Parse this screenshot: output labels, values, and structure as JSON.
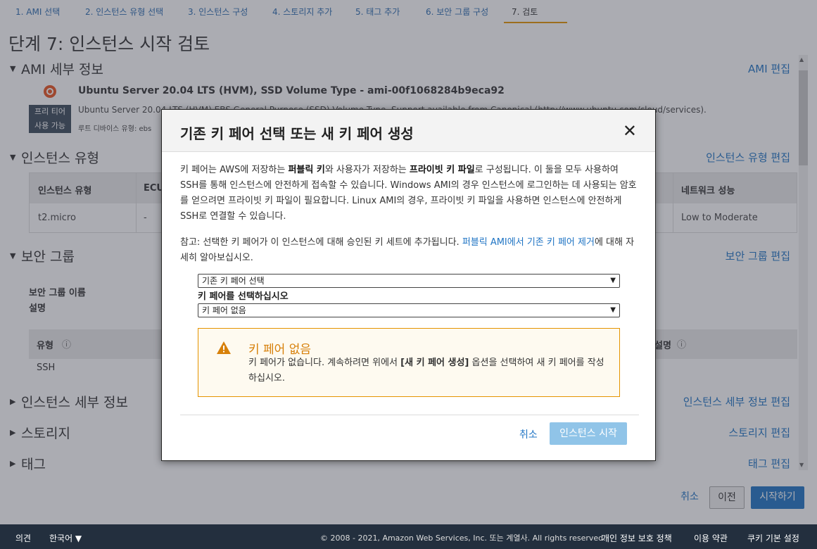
{
  "steps": [
    {
      "label": "1. AMI 선택"
    },
    {
      "label": "2. 인스턴스 유형 선택"
    },
    {
      "label": "3. 인스턴스 구성"
    },
    {
      "label": "4. 스토리지 추가"
    },
    {
      "label": "5. 태그 추가"
    },
    {
      "label": "6. 보안 그룹 구성"
    },
    {
      "label": "7. 검토"
    }
  ],
  "active_step": 7,
  "page_title": "단계 7: 인스턴스 시작 검토",
  "ami_section": {
    "title": "AMI 세부 정보",
    "edit_link": "AMI 편집",
    "name": "Ubuntu Server 20.04 LTS (HVM), SSD Volume Type - ami-00f1068284b9eca92",
    "description": "Ubuntu Server 20.04 LTS (HVM),EBS General Purpose (SSD) Volume Type. Support available from Canonical (http://www.ubuntu.com/cloud/services).",
    "root_device": "루트 디바이스 유형: ebs",
    "free_tier_line1": "프리 티어",
    "free_tier_line2": "사용 가능"
  },
  "instance_type_section": {
    "title": "인스턴스 유형",
    "edit_link": "인스턴스 유형 편집",
    "headers": [
      "인스턴스 유형",
      "ECU",
      "네트워크 성능"
    ],
    "row": [
      "t2.micro",
      "-",
      "Low to Moderate"
    ]
  },
  "security_group_section": {
    "title": "보안 그룹",
    "edit_link": "보안 그룹 편집",
    "name_label": "보안 그룹 이름",
    "desc_label": "설명",
    "table_headers": [
      "유형",
      "설명"
    ],
    "row": [
      "SSH"
    ]
  },
  "collapsed_sections": [
    {
      "title": "인스턴스 세부 정보",
      "edit_link": "인스턴스 세부 정보 편집"
    },
    {
      "title": "스토리지",
      "edit_link": "스토리지 편집"
    },
    {
      "title": "태그",
      "edit_link": "태그 편집"
    }
  ],
  "bottom_buttons": {
    "cancel": "취소",
    "previous": "이전",
    "launch": "시작하기"
  },
  "footer": {
    "feedback": "의견",
    "language": "한국어 ▼",
    "copyright": "© 2008 - 2021, Amazon Web Services, Inc. 또는 계열사. All rights reserved.",
    "privacy": "개인 정보 보호 정책",
    "terms": "이용 약관",
    "cookies": "쿠키 기본 설정"
  },
  "modal": {
    "title": "기존 키 페어 선택 또는 새 키 페어 생성",
    "close_icon": "close-icon",
    "para1": {
      "t1": "키 페어는 AWS에 저장하는 ",
      "b1": "퍼블릭 키",
      "t2": "와 사용자가 저장하는 ",
      "b2": "프라이빗 키 파일",
      "t3": "로 구성됩니다. 이 둘을 모두 사용하여 SSH를 통해 인스턴스에 안전하게 접속할 수 있습니다. Windows AMI의 경우 인스턴스에 로그인하는 데 사용되는 암호를 얻으려면 프라이빗 키 파일이 필요합니다. Linux AMI의 경우, 프라이빗 키 파일을 사용하면 인스턴스에 안전하게 SSH로 연결할 수 있습니다."
    },
    "para2": {
      "t1": "참고: 선택한 키 페어가 이 인스턴스에 대해 승인된 키 세트에 추가됩니다. ",
      "link": "퍼블릭 AMI에서 기존 키 페어 제거",
      "t2": "에 대해 자세히 알아보십시오."
    },
    "select1_value": "기존 키 페어 선택",
    "select2_label": "키 페어를 선택하십시오",
    "select2_value": "키 페어 없음",
    "warning": {
      "icon": "warning-icon",
      "title": "키 페어 없음",
      "t1": "키 페어가 없습니다. 계속하려면 위에서 ",
      "b1": "[새 키 페어 생성]",
      "t2": " 옵션을 선택하여 새 키 페어를 작성하십시오."
    },
    "cancel": "취소",
    "launch": "인스턴스 시작"
  },
  "colors": {
    "link": "#1f74c4",
    "accent": "#e59400",
    "warning_text": "#d7800a",
    "primary_button": "#1f74c4",
    "disabled_button": "#90c4e8",
    "footer_bg": "#232f3e"
  }
}
